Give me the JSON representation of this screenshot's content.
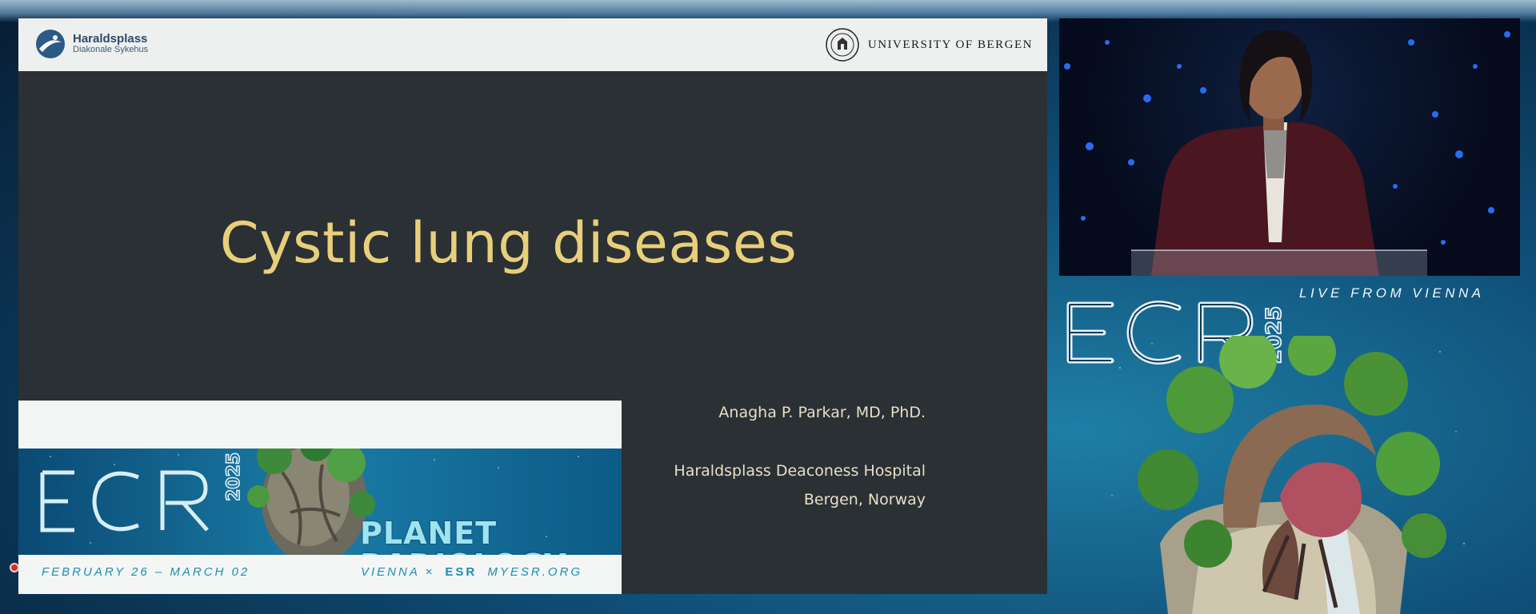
{
  "slide": {
    "left_logo": {
      "name": "Haraldsplass",
      "subtitle": "Diakonale Sykehus"
    },
    "right_logo": {
      "name": "UNIVERSITY OF BERGEN"
    },
    "title": "Cystic lung diseases",
    "author": "Anagha P. Parkar, MD, PhD.",
    "affiliation_line1": "Haraldsplass Deaconess Hospital",
    "affiliation_line2": "Bergen, Norway"
  },
  "banner": {
    "ecr_letters": "ECR",
    "year": "2025",
    "slogan_line1": "PLANET",
    "slogan_line2": "RADIOLOGY",
    "dates": "FEBRUARY 26 – MARCH 02",
    "location": "VIENNA ×",
    "org_logo": "ESR",
    "website": "MYESR.ORG"
  },
  "brand_panel": {
    "ecr_letters": "ECR",
    "year": "2025",
    "tagline": "LIVE FROM VIENNA"
  },
  "colors": {
    "slide_bg": "#2b3035",
    "title": "#e8cf7a",
    "ecr_cyan": "#1a8fb3",
    "recording": "#d0302a"
  },
  "icons": {
    "left_logo": "haraldsplass-icon",
    "right_logo": "university-seal-icon",
    "recording": "record-dot-icon"
  }
}
